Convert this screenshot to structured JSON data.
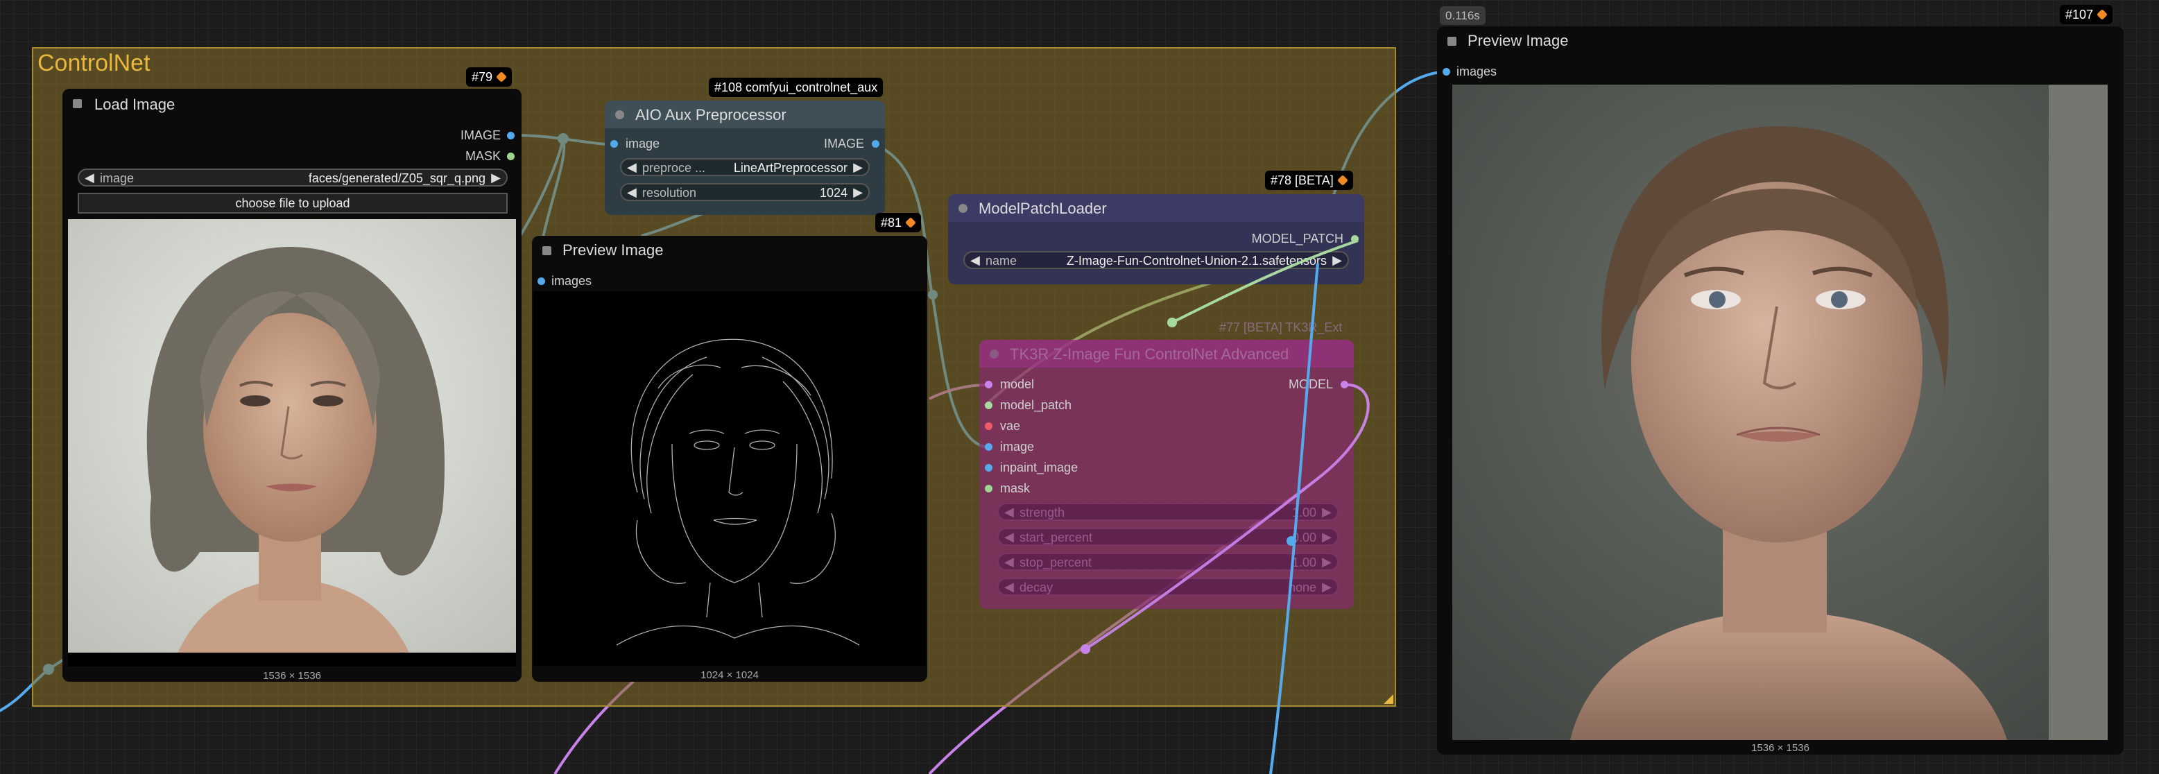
{
  "group": {
    "title": "ControlNet"
  },
  "timing": "0.116s",
  "colors": {
    "image_link": "#55aaee",
    "model_link": "#c783e9",
    "patch_link": "#a7d8a0",
    "group_bg": "#887028"
  },
  "icons": {
    "node_badge": "fox-icon",
    "arrow_left": "◀",
    "arrow_right": "▶"
  },
  "load_image": {
    "badge": "#79",
    "title": "Load Image",
    "outputs": [
      "IMAGE",
      "MASK"
    ],
    "image_widget": {
      "label": "image",
      "value": "faces/generated/Z05_sqr_q.png"
    },
    "upload_label": "choose file to upload",
    "caption": "1536 × 1536"
  },
  "aio": {
    "badge": "#108 comfyui_controlnet_aux",
    "title": "AIO Aux Preprocessor",
    "input": "image",
    "output": "IMAGE",
    "widgets": [
      {
        "label": "preproce ...",
        "value": "LineArtPreprocessor"
      },
      {
        "label": "resolution",
        "value": "1024"
      }
    ]
  },
  "preview_mid": {
    "badge": "#81",
    "title": "Preview Image",
    "input": "images",
    "caption": "1024 × 1024"
  },
  "patch_loader": {
    "badge": "#78 [BETA]",
    "title": "ModelPatchLoader",
    "output": "MODEL_PATCH",
    "widget": {
      "label": "name",
      "value": "Z-Image-Fun-Controlnet-Union-2.1.safetensors"
    }
  },
  "tk_node": {
    "badge": "#77 [BETA] TK3R_Ext",
    "title": "TK3R Z-Image Fun ControlNet Advanced",
    "inputs": [
      "model",
      "model_patch",
      "vae",
      "image",
      "inpaint_image",
      "mask"
    ],
    "output": "MODEL",
    "widgets": [
      {
        "label": "strength",
        "value": "1.00"
      },
      {
        "label": "start_percent",
        "value": "0.00"
      },
      {
        "label": "stop_percent",
        "value": "1.00"
      },
      {
        "label": "decay",
        "value": "none"
      }
    ]
  },
  "preview_right": {
    "badge": "#107",
    "title": "Preview Image",
    "input": "images",
    "caption": "1536 × 1536"
  }
}
